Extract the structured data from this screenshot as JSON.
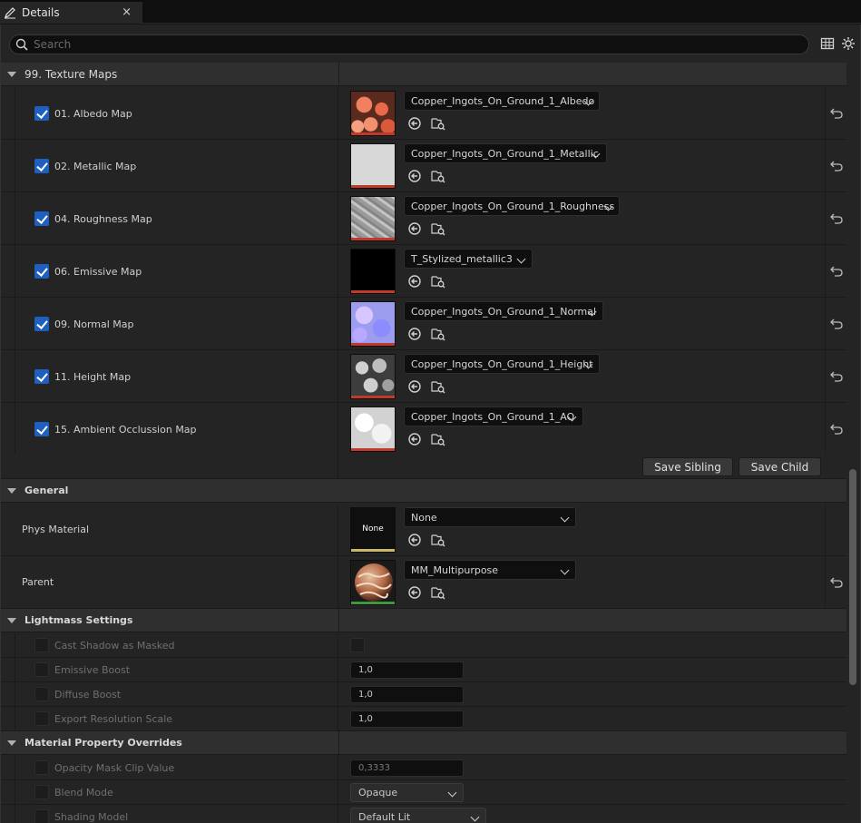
{
  "tab": {
    "title": "Details",
    "icon": "pencil-icon",
    "close": "×"
  },
  "search": {
    "placeholder": "Search",
    "value": ""
  },
  "toolbar": {
    "icons": [
      "table-view-icon",
      "settings-gear-icon"
    ]
  },
  "texture_maps": {
    "category": "99. Texture Maps",
    "items": [
      {
        "label": "01. Albedo Map",
        "checked": true,
        "asset": "Copper_Ingots_On_Ground_1_Albedo",
        "thumb": "albedo"
      },
      {
        "label": "02. Metallic Map",
        "checked": true,
        "asset": "Copper_Ingots_On_Ground_1_Metallic",
        "thumb": "metallic"
      },
      {
        "label": "04. Roughness Map",
        "checked": true,
        "asset": "Copper_Ingots_On_Ground_1_Roughness",
        "thumb": "roughness"
      },
      {
        "label": "06. Emissive Map",
        "checked": true,
        "asset": "T_Stylized_metallic3",
        "thumb": "emissive"
      },
      {
        "label": "09. Normal Map",
        "checked": true,
        "asset": "Copper_Ingots_On_Ground_1_Normal",
        "thumb": "normal"
      },
      {
        "label": "11. Height Map",
        "checked": true,
        "asset": "Copper_Ingots_On_Ground_1_Height",
        "thumb": "height"
      },
      {
        "label": "15. Ambient Occlussion Map",
        "checked": true,
        "asset": "Copper_Ingots_On_Ground_1_AO",
        "thumb": "ao"
      }
    ]
  },
  "save_buttons": {
    "sibling": "Save Sibling",
    "child": "Save Child"
  },
  "general": {
    "category": "General",
    "phys_material": {
      "label": "Phys Material",
      "thumb_text": "None",
      "value": "None"
    },
    "parent": {
      "label": "Parent",
      "value": "MM_Multipurpose"
    }
  },
  "lightmass": {
    "category": "Lightmass Settings",
    "cast_shadow": {
      "label": "Cast Shadow as Masked"
    },
    "emissive_boost": {
      "label": "Emissive Boost",
      "value": "1,0"
    },
    "diffuse_boost": {
      "label": "Diffuse Boost",
      "value": "1,0"
    },
    "export_res": {
      "label": "Export Resolution Scale",
      "value": "1,0"
    }
  },
  "overrides": {
    "category": "Material Property Overrides",
    "opacity_mask": {
      "label": "Opacity Mask Clip Value",
      "value": "0,3333"
    },
    "blend_mode": {
      "label": "Blend Mode",
      "value": "Opaque"
    },
    "shading_model": {
      "label": "Shading Model",
      "value": "Default Lit"
    }
  },
  "colors": {
    "accent": "#1f5fbf",
    "thumb_bar_red": "#c0392b",
    "thumb_bar_green": "#3c9a3c",
    "thumb_bar_yellow": "#c8b86a"
  }
}
